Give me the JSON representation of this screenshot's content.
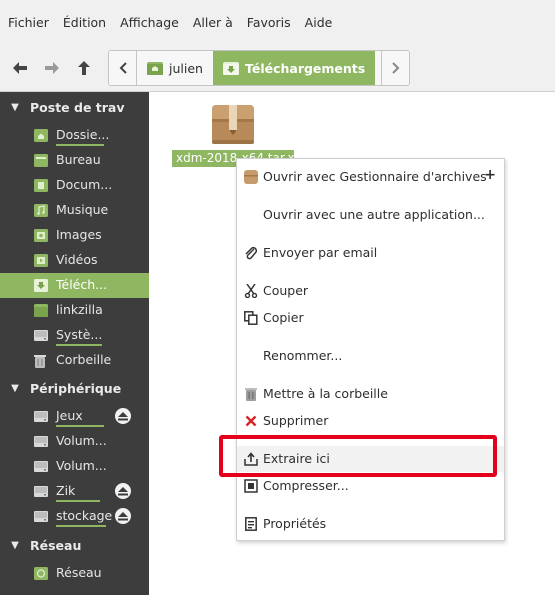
{
  "menubar": {
    "items": [
      "Fichier",
      "Édition",
      "Affichage",
      "Aller à",
      "Favoris",
      "Aide"
    ]
  },
  "toolbar": {
    "back_icon": "arrow-left-icon",
    "forward_icon": "arrow-right-icon",
    "up_icon": "arrow-up-icon",
    "crumbs": [
      "julien",
      "Téléchargements"
    ]
  },
  "sidebar": {
    "sections": [
      {
        "label": "Poste de trav",
        "items": [
          {
            "label": "Dossie...",
            "icon": "home-folder-icon"
          },
          {
            "label": "Bureau",
            "icon": "desktop-folder-icon"
          },
          {
            "label": "Docum...",
            "icon": "documents-folder-icon"
          },
          {
            "label": "Musique",
            "icon": "music-folder-icon"
          },
          {
            "label": "Images",
            "icon": "pictures-folder-icon"
          },
          {
            "label": "Vidéos",
            "icon": "videos-folder-icon"
          },
          {
            "label": "Téléch...",
            "icon": "downloads-folder-icon"
          },
          {
            "label": "linkzilla",
            "icon": "folder-icon"
          },
          {
            "label": "Systè...",
            "icon": "drive-icon"
          },
          {
            "label": "Corbeille",
            "icon": "trash-icon"
          }
        ]
      },
      {
        "label": "Périphérique",
        "items": [
          {
            "label": "Jeux",
            "icon": "drive-icon"
          },
          {
            "label": "Volum...",
            "icon": "drive-icon"
          },
          {
            "label": "Volum...",
            "icon": "drive-icon"
          },
          {
            "label": "Zik",
            "icon": "drive-icon"
          },
          {
            "label": "stockage",
            "icon": "drive-icon"
          }
        ]
      },
      {
        "label": "Réseau",
        "items": [
          {
            "label": "Réseau",
            "icon": "network-icon"
          }
        ]
      }
    ]
  },
  "content": {
    "file_name": "xdm-2018-x64.tar.xz",
    "file_icon": "archive-package-icon"
  },
  "context_menu": {
    "items": [
      {
        "label": "Ouvrir avec Gestionnaire d'archives",
        "icon": "archive-manager-icon"
      },
      {
        "label": "Ouvrir avec une autre application...",
        "icon": ""
      },
      {
        "label": "Envoyer par email",
        "icon": "attachment-icon"
      },
      {
        "label": "Couper",
        "icon": "scissors-icon"
      },
      {
        "label": "Copier",
        "icon": "copy-icon"
      },
      {
        "label": "Renommer...",
        "icon": ""
      },
      {
        "label": "Mettre à la corbeille",
        "icon": "trash-icon"
      },
      {
        "label": "Supprimer",
        "icon": "delete-x-icon"
      },
      {
        "label": "Extraire ici",
        "icon": "extract-icon"
      },
      {
        "label": "Compresser...",
        "icon": "compress-icon"
      },
      {
        "label": "Propriétés",
        "icon": "properties-icon"
      }
    ],
    "submenu_indicator": "+"
  },
  "colors": {
    "accent": "#8fb661",
    "sidebar_bg": "#3d3d3d",
    "highlight_box": "#e4001b"
  }
}
